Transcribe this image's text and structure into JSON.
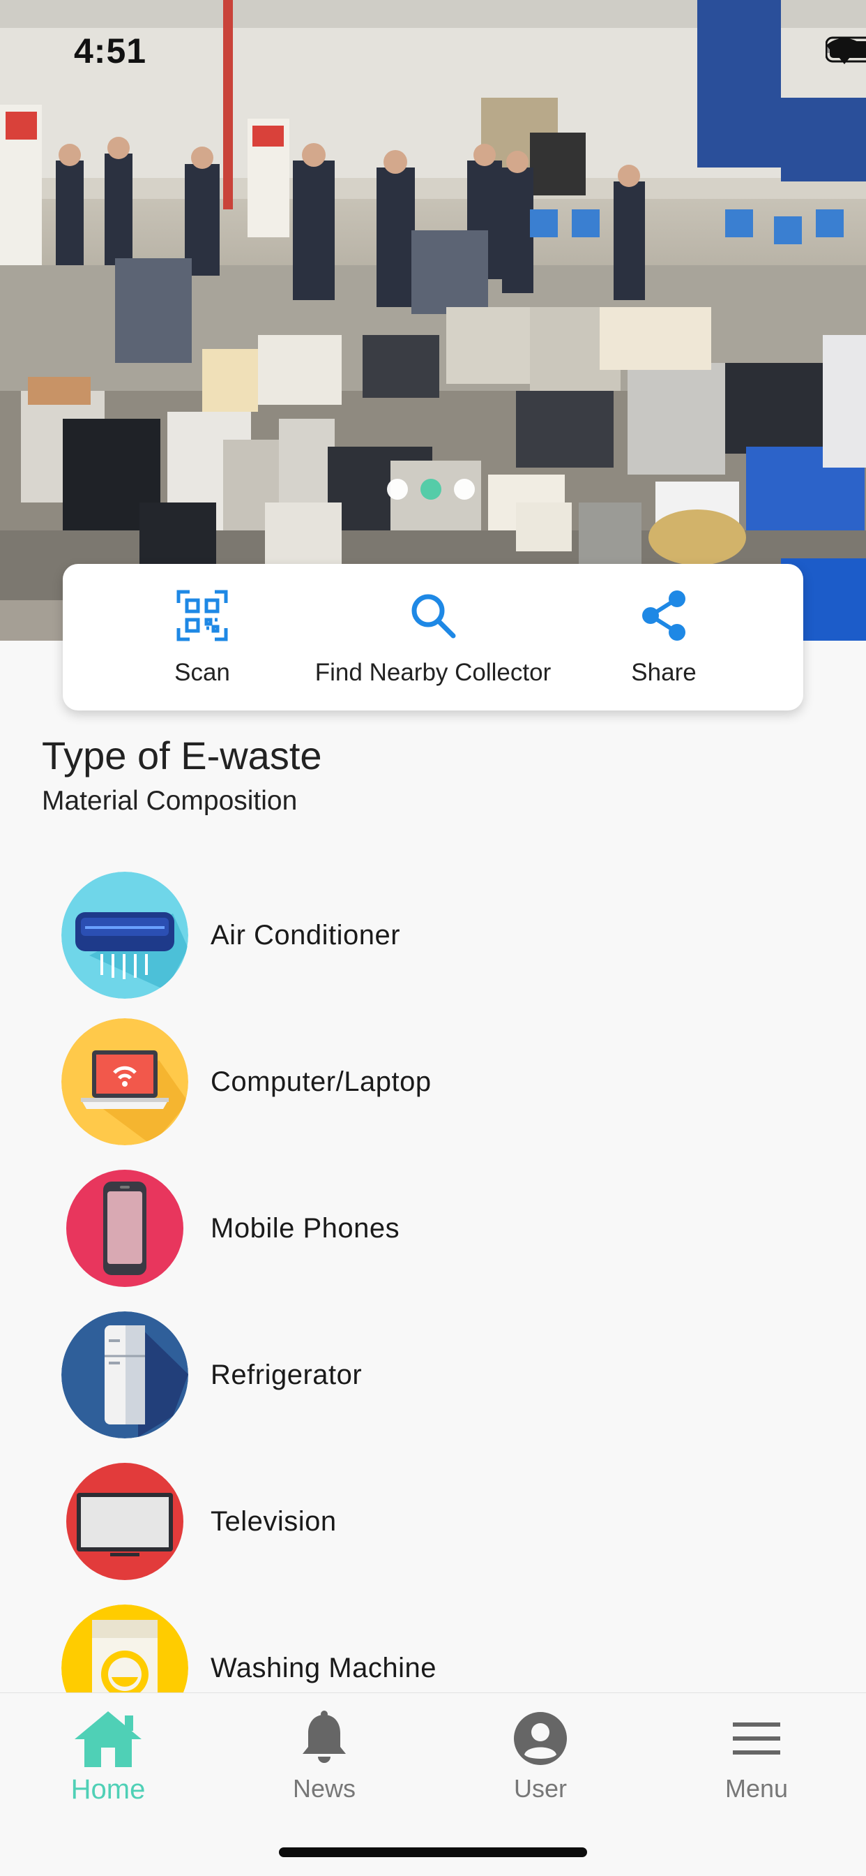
{
  "status_bar": {
    "time": "4:51"
  },
  "hero": {
    "slides_count": 3,
    "active_slide_index": 1
  },
  "actions": {
    "scan_label": "Scan",
    "find_label": "Find Nearby Collector",
    "share_label": "Share",
    "accent_color": "#1e88e5"
  },
  "section": {
    "title": "Type of E-waste",
    "subtitle": "Material Composition"
  },
  "ewaste_types": [
    {
      "label": "Air Conditioner",
      "icon": "air-conditioner-icon",
      "color": "#6fd6e9"
    },
    {
      "label": "Computer/Laptop",
      "icon": "laptop-icon",
      "color": "#ffc94a"
    },
    {
      "label": "Mobile Phones",
      "icon": "mobile-phone-icon",
      "color": "#e8365d"
    },
    {
      "label": "Refrigerator",
      "icon": "refrigerator-icon",
      "color": "#2f5f9a"
    },
    {
      "label": "Television",
      "icon": "television-icon",
      "color": "#e23b3b"
    },
    {
      "label": "Washing Machine",
      "icon": "washing-machine-icon",
      "color": "#ffcc00"
    }
  ],
  "tabbar": {
    "home_label": "Home",
    "news_label": "News",
    "user_label": "User",
    "menu_label": "Menu",
    "active_color": "#4fd0b6",
    "inactive_color": "#777777"
  }
}
